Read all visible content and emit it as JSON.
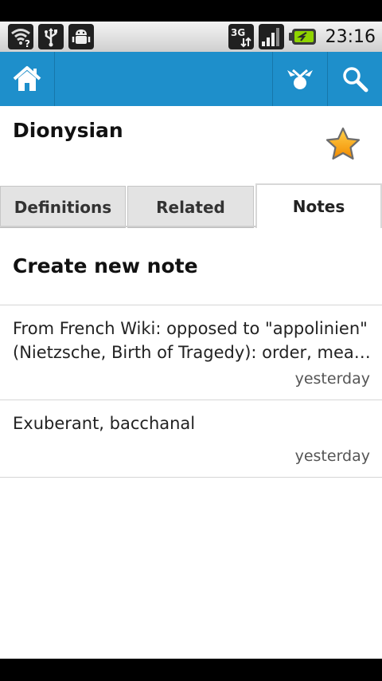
{
  "status_bar": {
    "icons": [
      "wifi-question-icon",
      "usb-icon",
      "android-debug-icon"
    ],
    "network": "3G",
    "clock": "23:16"
  },
  "action_bar": {
    "home_icon": "home-icon",
    "share_icon": "share-icon",
    "search_icon": "search-icon",
    "accent": "#1e8fcb"
  },
  "word": {
    "title": "Dionysian",
    "favorite_icon": "star-icon"
  },
  "tabs": [
    {
      "label": "Definitions",
      "active": false
    },
    {
      "label": "Related",
      "active": false
    },
    {
      "label": "Notes",
      "active": true
    }
  ],
  "notes": {
    "create_label": "Create new note",
    "items": [
      {
        "line1": "From French Wiki: opposed to \"appolinien\"",
        "line2": "(Nietzsche, Birth of Tragedy): order, meas...",
        "date": "yesterday"
      },
      {
        "line1": "Exuberant, bacchanal",
        "date": "yesterday"
      }
    ]
  }
}
